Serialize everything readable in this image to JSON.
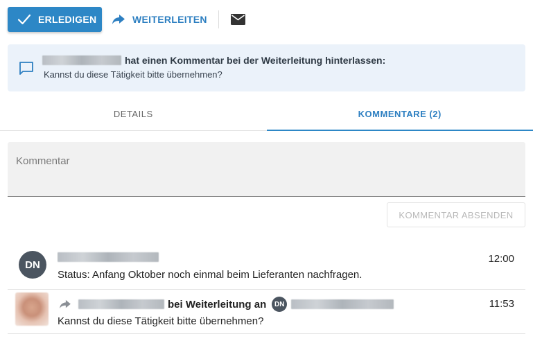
{
  "toolbar": {
    "done_label": "ERLEDIGEN",
    "forward_label": "WEITERLEITEN",
    "done_icon": "check-icon",
    "forward_icon": "forward-arrow-icon",
    "mail_icon": "envelope-icon"
  },
  "notice": {
    "icon": "chat-bubble-icon",
    "headline": "hat einen Kommentar bei der Weiterleitung hinterlassen:",
    "message": "Kannst du diese Tätigkeit bitte übernehmen?"
  },
  "tabs": [
    {
      "label": "DETAILS",
      "active": false
    },
    {
      "label": "KOMMENTARE (2)",
      "active": true
    }
  ],
  "comment_input": {
    "placeholder": "Kommentar"
  },
  "send_button": {
    "label": "KOMMENTAR ABSENDEN"
  },
  "comments": [
    {
      "avatar_initials": "DN",
      "time": "12:00",
      "text": "Status: Anfang Oktober noch einmal beim Lieferanten nachfragen."
    },
    {
      "action_text": "bei Weiterleitung an",
      "recipient_initials": "DN",
      "time": "11:53",
      "text": "Kannst du diese Tätigkeit bitte übernehmen?"
    }
  ],
  "colors": {
    "accent": "#2d87c6",
    "notice_bg": "#ebf2fa",
    "avatar_bg": "#4b5560"
  }
}
